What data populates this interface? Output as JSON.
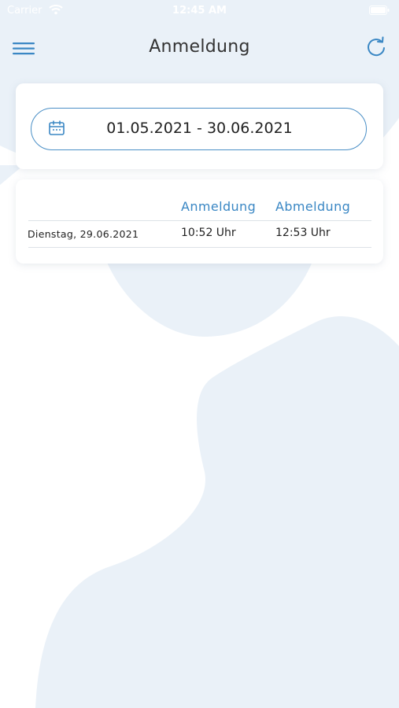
{
  "status_bar": {
    "carrier": "Carrier",
    "time": "12:45 AM"
  },
  "header": {
    "title": "Anmeldung",
    "menu_icon": "hamburger-menu-icon",
    "refresh_icon": "refresh-icon"
  },
  "date_filter": {
    "icon": "calendar-icon",
    "range": "01.05.2021 - 30.06.2021"
  },
  "table": {
    "columns": [
      "Anmeldung",
      "Abmeldung"
    ],
    "rows": [
      {
        "date": "Dienstag, 29.06.2021",
        "login": "10:52 Uhr",
        "logout": "12:53 Uhr"
      }
    ]
  },
  "colors": {
    "accent": "#3a87c4",
    "background_shape": "#eaf1f8",
    "text": "#222222"
  }
}
